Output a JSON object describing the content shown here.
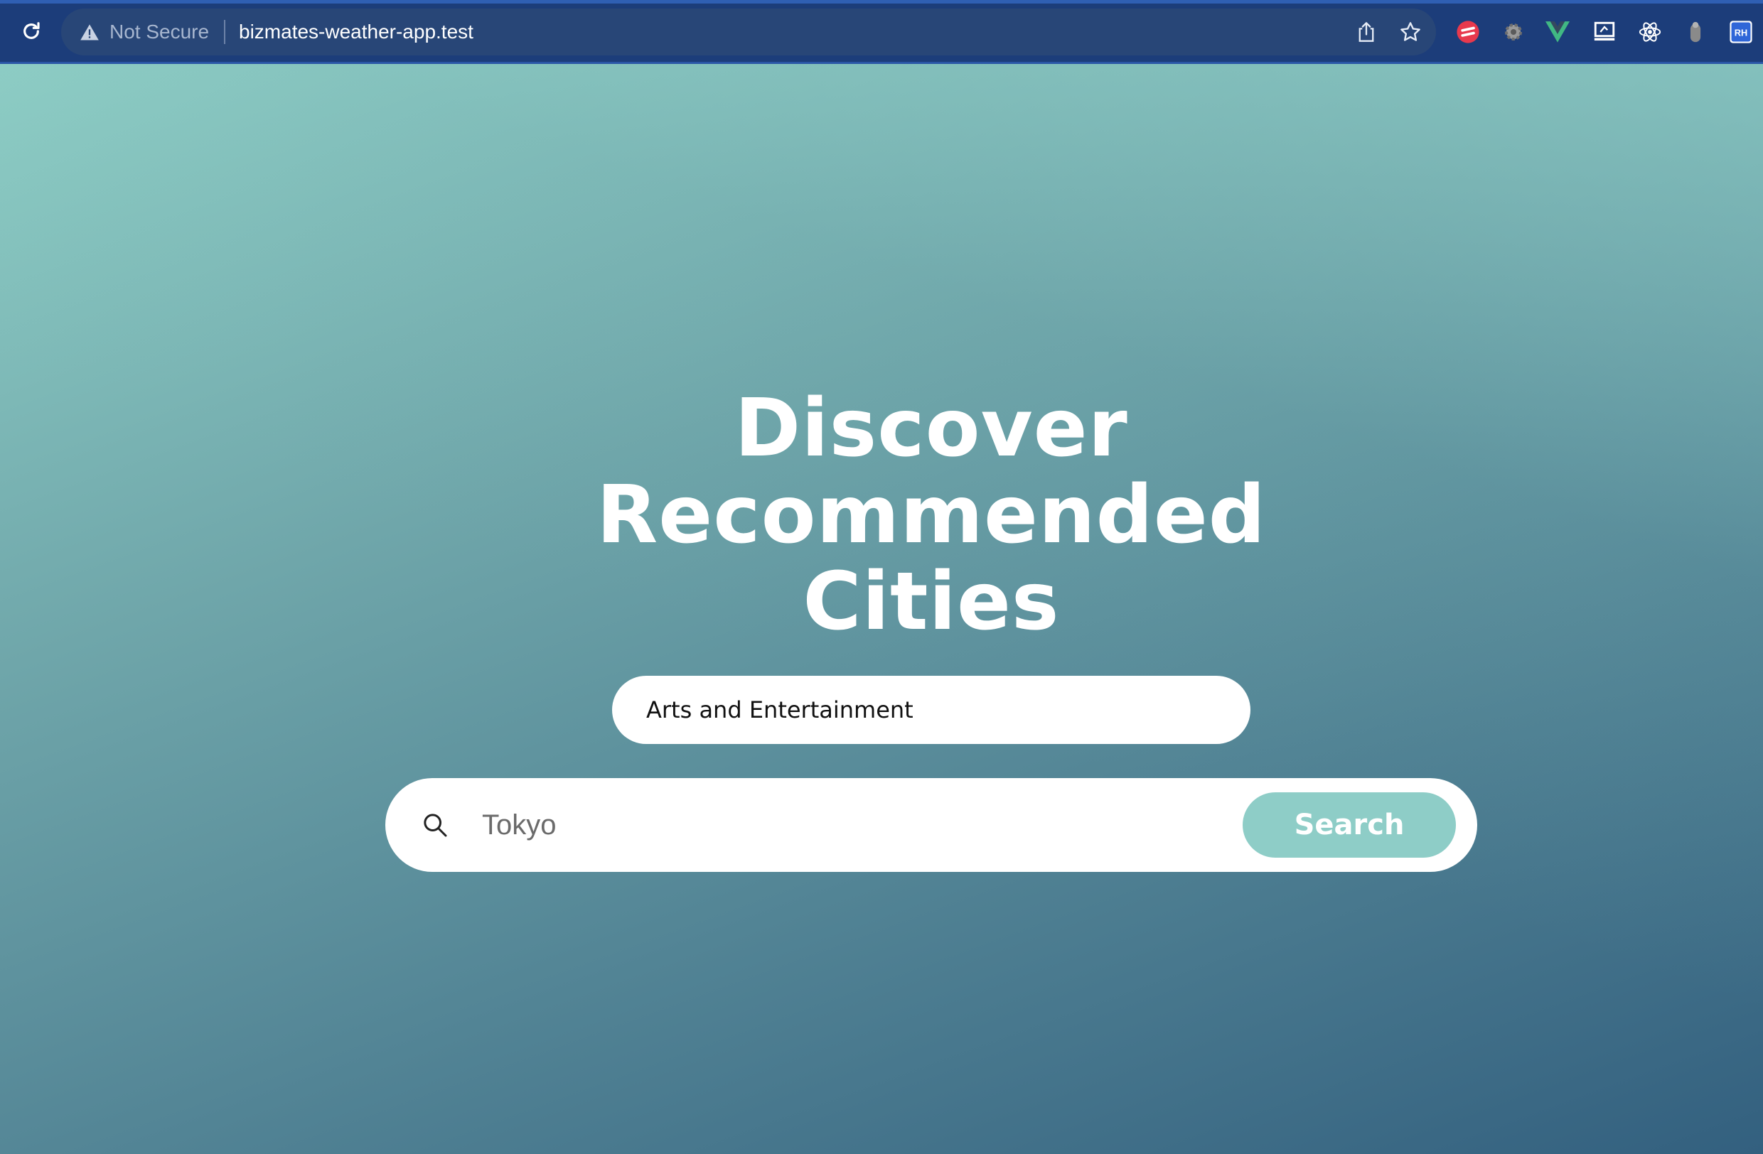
{
  "browser": {
    "security_label": "Not Secure",
    "url": "bizmates-weather-app.test",
    "extensions": [
      "red-stripe-extension-icon",
      "gear-extension-icon",
      "vue-devtools-icon",
      "screen-capture-icon",
      "react-devtools-icon",
      "pill-extension-icon",
      "rh-extension-icon"
    ],
    "extension_rh_label": "RH"
  },
  "hero": {
    "title_line1": "Discover",
    "title_line2": "Recommended",
    "title_line3": "Cities"
  },
  "category": {
    "selected": "Arts and Entertainment"
  },
  "search": {
    "placeholder": "Tokyo",
    "button_label": "Search"
  },
  "colors": {
    "chrome_bg": "#1c3d7a",
    "omnibox_bg": "#284677",
    "gradient_top": "#8fcfc6",
    "gradient_bottom": "#33607f",
    "search_button": "#8ecdc7"
  }
}
